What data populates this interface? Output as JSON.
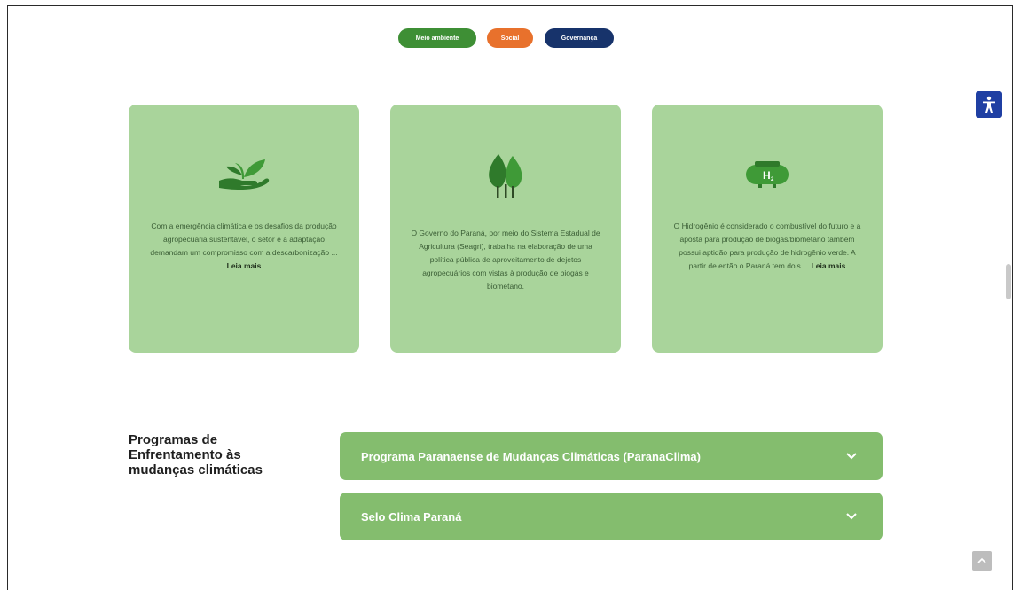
{
  "nav_pills": {
    "environmental": "Meio ambiente",
    "social": "Social",
    "governance": "Governança"
  },
  "cards": [
    {
      "icon": "hand-plant-icon",
      "text": "Com a emergência climática e os desafios da produção agropecuária sustentável, o setor e a adaptação demandam um compromisso com a descarbonização ...",
      "read_more": "Leia mais"
    },
    {
      "icon": "trees-icon",
      "text": "O Governo do Paraná, por meio do Sistema Estadual de Agricultura (Seagri), trabalha na elaboração de uma política pública de aproveitamento de dejetos agropecuários com vistas à produção de biogás e biometano."
    },
    {
      "icon": "hydrogen-tank-icon",
      "text": "O Hidrogênio é considerado o combustível do futuro e a aposta para produção de biogás/biometano também possui aptidão para produção de hidrogênio verde. A partir de então o Paraná tem dois ...",
      "read_more": "Leia mais"
    }
  ],
  "section": {
    "title": "Programas de Enfrentamento às mudanças climáticas"
  },
  "accordion": [
    {
      "label": "Programa Paranaense de Mudanças Climáticas (ParanaClima)"
    },
    {
      "label": "Selo Clima Paraná"
    }
  ],
  "colors": {
    "card_bg": "#a9d49b",
    "accordion_bg": "#84bd6e",
    "environmental_pill": "#3e8f35",
    "social_pill": "#e8712c",
    "governance_pill": "#17336b",
    "accessibility_button": "#1f3fa3"
  }
}
